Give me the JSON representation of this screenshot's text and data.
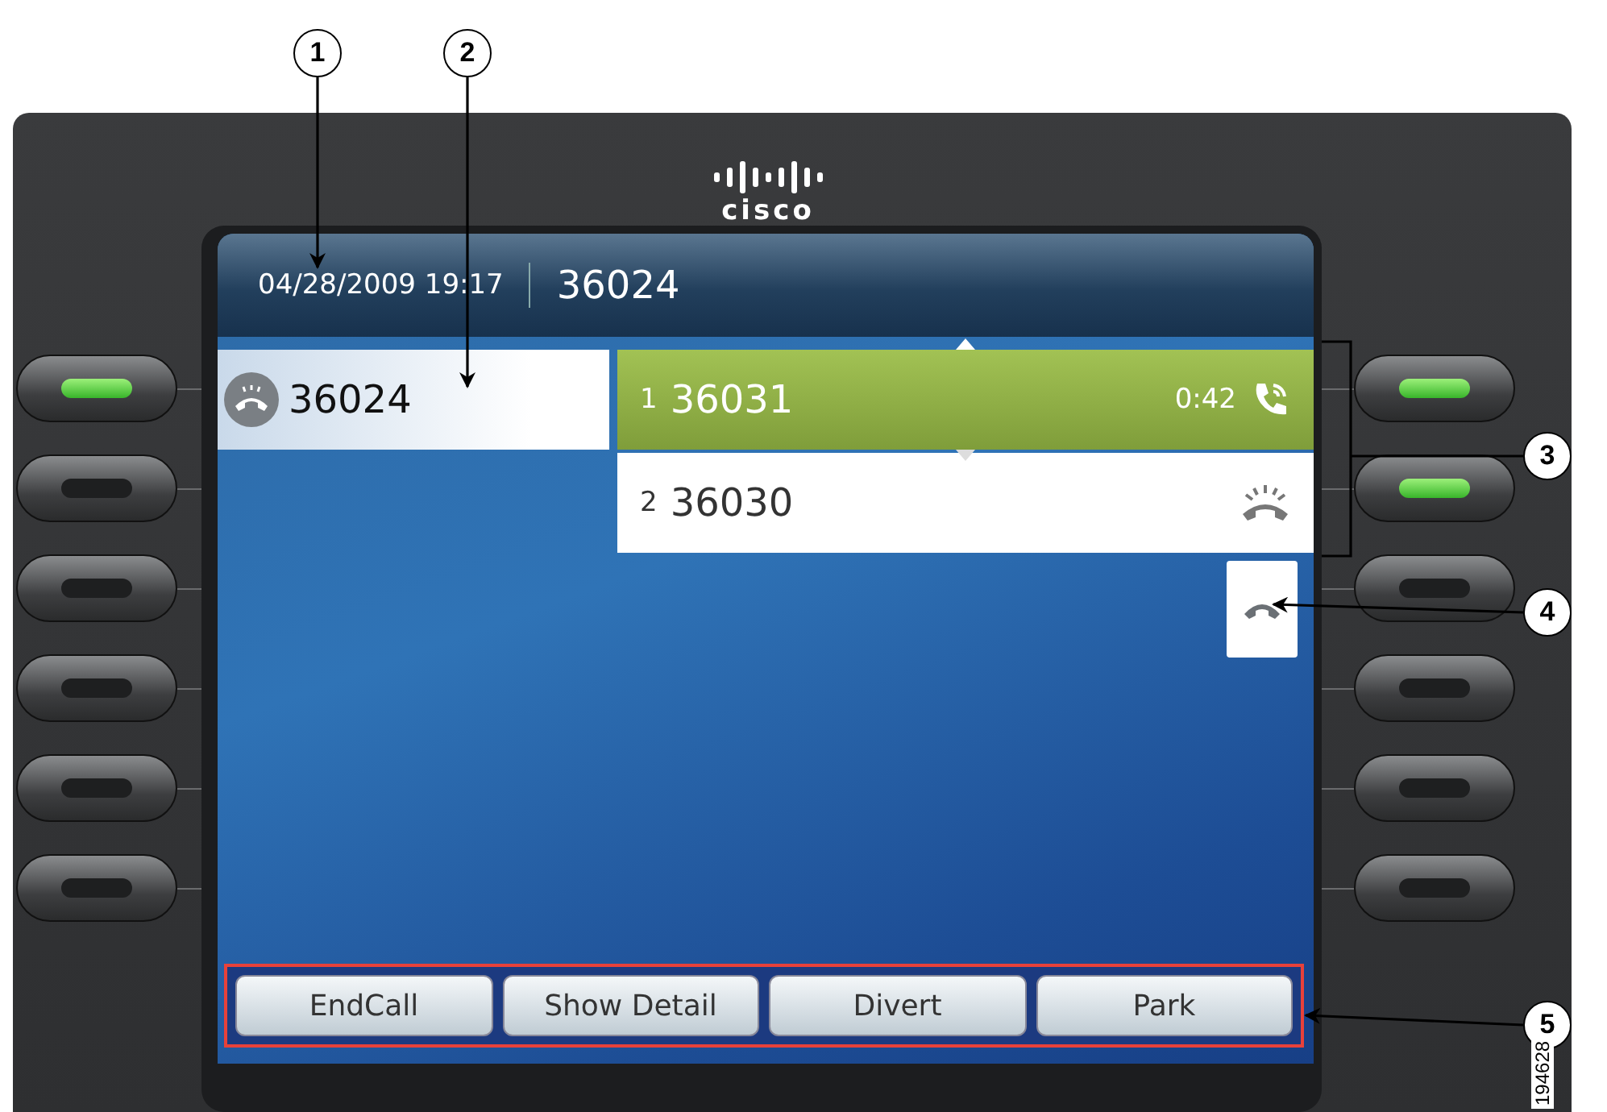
{
  "logo": {
    "wordmark": "cisco"
  },
  "header": {
    "datetime": "04/28/2009 19:17",
    "line_number": "36024"
  },
  "lines": [
    {
      "number": "36024",
      "selected": true
    }
  ],
  "calls": [
    {
      "index": "1",
      "number": "36031",
      "duration": "0:42",
      "kind": "connected",
      "selected": true
    },
    {
      "index": "2",
      "number": "36030",
      "kind": "ringing",
      "selected": false
    }
  ],
  "softkeys": [
    "EndCall",
    "Show Detail",
    "Divert",
    "Park"
  ],
  "left_buttons": [
    {
      "lit": true
    },
    {
      "lit": false
    },
    {
      "lit": false
    },
    {
      "lit": false
    },
    {
      "lit": false
    },
    {
      "lit": false
    }
  ],
  "right_buttons": [
    {
      "lit": true
    },
    {
      "lit": true
    },
    {
      "lit": false
    },
    {
      "lit": false
    },
    {
      "lit": false
    },
    {
      "lit": false
    }
  ],
  "callouts": [
    "1",
    "2",
    "3",
    "4",
    "5"
  ],
  "figure_id": "194628"
}
